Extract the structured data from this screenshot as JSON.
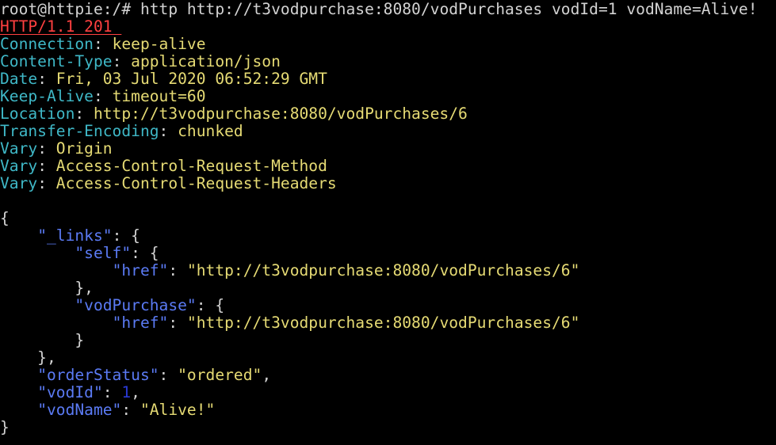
{
  "terminal": {
    "prompt": "root@httpie:/# ",
    "command": "http http://t3vodpurchase:8080/vodPurchases vodId=1 vodName=Alive!"
  },
  "response": {
    "status_line": "HTTP/1.1 201 ",
    "headers": [
      {
        "name": "Connection",
        "value": "keep-alive"
      },
      {
        "name": "Content-Type",
        "value": "application/json"
      },
      {
        "name": "Date",
        "value": "Fri, 03 Jul 2020 06:52:29 GMT"
      },
      {
        "name": "Keep-Alive",
        "value": "timeout=60"
      },
      {
        "name": "Location",
        "value": "http://t3vodpurchase:8080/vodPurchases/6"
      },
      {
        "name": "Transfer-Encoding",
        "value": "chunked"
      },
      {
        "name": "Vary",
        "value": "Origin"
      },
      {
        "name": "Vary",
        "value": "Access-Control-Request-Method"
      },
      {
        "name": "Vary",
        "value": "Access-Control-Request-Headers"
      }
    ],
    "body": {
      "links_key": "\"_links\"",
      "self_key": "\"self\"",
      "self_href_key": "\"href\"",
      "self_href_value": "\"http://t3vodpurchase:8080/vodPurchases/6\"",
      "vodpurchase_key": "\"vodPurchase\"",
      "vodpurchase_href_key": "\"href\"",
      "vodpurchase_href_value": "\"http://t3vodpurchase:8080/vodPurchases/6\"",
      "orderstatus_key": "\"orderStatus\"",
      "orderstatus_value": "\"ordered\"",
      "vodid_key": "\"vodId\"",
      "vodid_value": "1",
      "vodname_key": "\"vodName\"",
      "vodname_value": "\"Alive!\""
    }
  },
  "colors": {
    "background": "#000000",
    "status": "#ff4040",
    "header_name": "#3fb8c7",
    "header_value": "#e6db74",
    "json_key": "#5b7bf5",
    "json_string": "#e6db74",
    "json_number": "#2a3ad6"
  }
}
